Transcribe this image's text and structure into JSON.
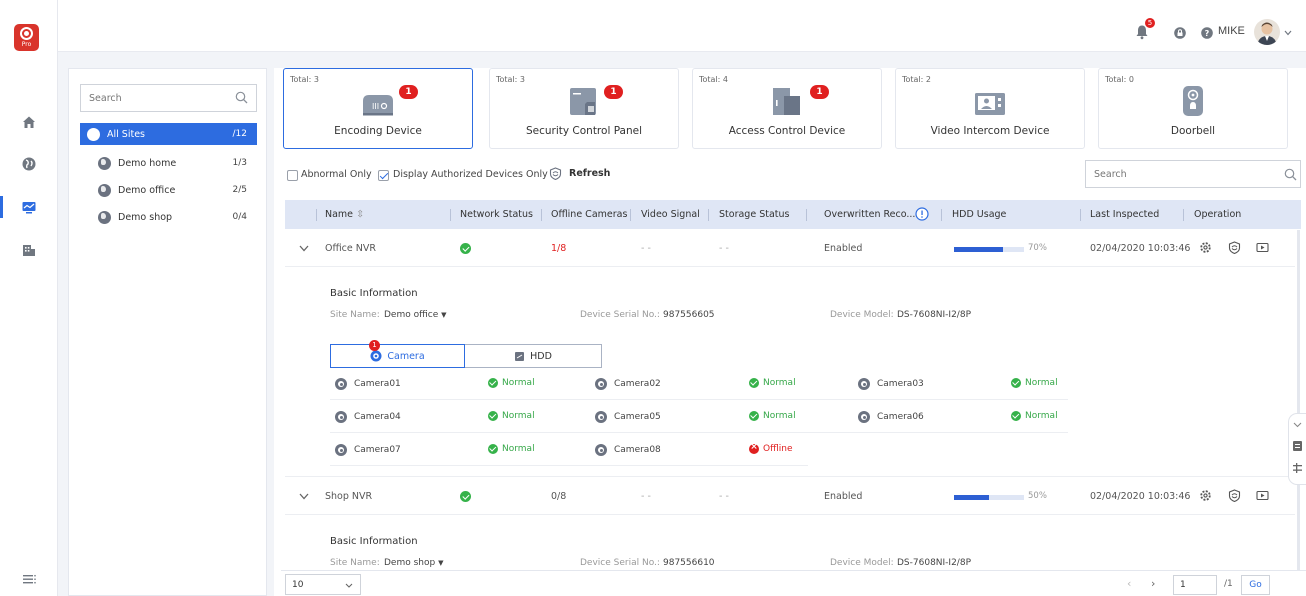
{
  "topbar": {
    "notification_count": "5",
    "user_name": "MIKE"
  },
  "logo": {
    "sub": "Pro"
  },
  "sites": {
    "search_placeholder": "Search",
    "items": [
      {
        "label": "All Sites",
        "count": "/12"
      },
      {
        "label": "Demo home",
        "count": "1/3"
      },
      {
        "label": "Demo office",
        "count": "2/5"
      },
      {
        "label": "Demo shop",
        "count": "0/4"
      }
    ]
  },
  "cards": [
    {
      "total": "Total: 3",
      "label": "Encoding Device",
      "badge": "1"
    },
    {
      "total": "Total: 3",
      "label": "Security Control Panel",
      "badge": "1"
    },
    {
      "total": "Total: 4",
      "label": "Access Control Device",
      "badge": "1"
    },
    {
      "total": "Total: 2",
      "label": "Video Intercom Device"
    },
    {
      "total": "Total: 0",
      "label": "Doorbell"
    }
  ],
  "filters": {
    "abnormal_only": "Abnormal Only",
    "authorized_only": "Display Authorized Devices Only",
    "refresh": "Refresh",
    "search_placeholder": "Search"
  },
  "table": {
    "headers": {
      "name": "Name",
      "network": "Network Status",
      "offline": "Offline Cameras",
      "video": "Video Signal",
      "storage": "Storage Status",
      "overwritten": "Overwritten Reco...",
      "hdd": "HDD Usage",
      "inspected": "Last Inspected",
      "operation": "Operation"
    },
    "rows": [
      {
        "name": "Office NVR",
        "offline": "1/8",
        "video": "- -",
        "storage": "- -",
        "overwritten": "Enabled",
        "hdd_percent": 70,
        "hdd_label": "70%",
        "inspected": "02/04/2020 10:03:46"
      },
      {
        "name": "Shop NVR",
        "offline": "0/8",
        "video": "- -",
        "storage": "- -",
        "overwritten": "Enabled",
        "hdd_percent": 50,
        "hdd_label": "50%",
        "inspected": "02/04/2020 10:03:46"
      }
    ]
  },
  "detail1": {
    "title": "Basic Information",
    "site_label": "Site Name:",
    "site_value": "Demo office",
    "serial_label": "Device Serial No.:",
    "serial_value": "987556605",
    "model_label": "Device Model:",
    "model_value": "DS-7608NI-I2/8P",
    "tab_camera": "Camera",
    "tab_camera_badge": "1",
    "tab_hdd": "HDD",
    "cameras": [
      {
        "name": "Camera01",
        "status": "Normal"
      },
      {
        "name": "Camera02",
        "status": "Normal"
      },
      {
        "name": "Camera03",
        "status": "Normal"
      },
      {
        "name": "Camera04",
        "status": "Normal"
      },
      {
        "name": "Camera05",
        "status": "Normal"
      },
      {
        "name": "Camera06",
        "status": "Normal"
      },
      {
        "name": "Camera07",
        "status": "Normal"
      },
      {
        "name": "Camera08",
        "status": "Offline"
      }
    ]
  },
  "detail2": {
    "title": "Basic Information",
    "site_label": "Site Name:",
    "site_value": "Demo shop",
    "serial_label": "Device Serial No.:",
    "serial_value": "987556610",
    "model_label": "Device Model:",
    "model_value": "DS-7608NI-I2/8P"
  },
  "footer": {
    "page_size": "10",
    "page": "1",
    "total_pages": "/1",
    "go": "Go"
  },
  "colors": {
    "accent": "#2d6ce0",
    "alert": "#e02020",
    "ok": "#36b24a",
    "header_bg": "#dfe6f5"
  }
}
